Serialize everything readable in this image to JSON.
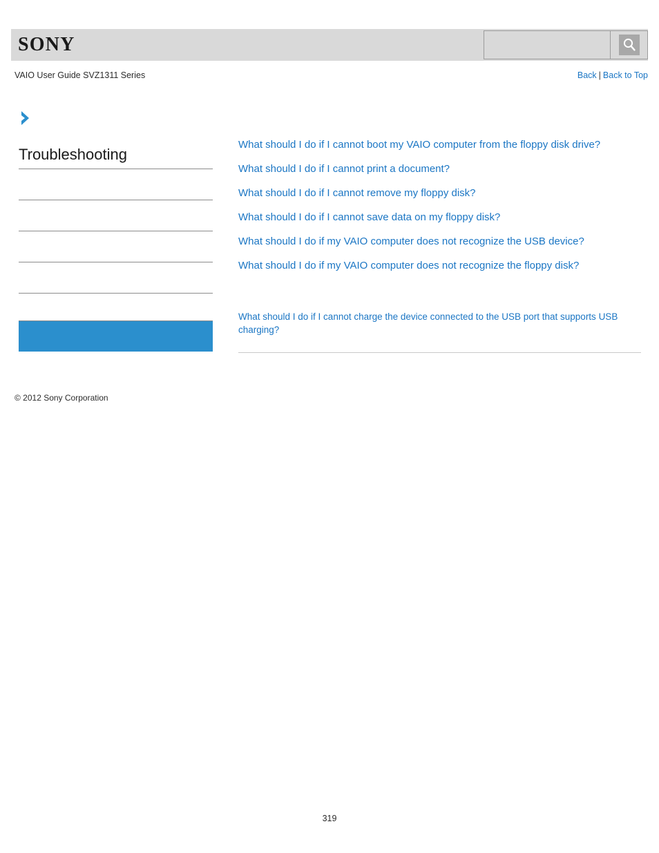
{
  "header": {
    "logo_text": "SONY",
    "search": {
      "value": "",
      "placeholder": "",
      "icon": "search-icon"
    }
  },
  "subheader": {
    "guide_title": "VAIO User Guide SVZ1311 Series",
    "back_label": "Back",
    "separator": "|",
    "back_to_top_label": "Back to Top"
  },
  "sidebar": {
    "chevron_icon": "chevron-right-icon",
    "title": "Troubleshooting",
    "entries": [
      "",
      "",
      "",
      ""
    ],
    "highlight_box": {
      "label": "",
      "color": "#2b8fcd"
    }
  },
  "content": {
    "links": [
      "What should I do if I cannot boot my VAIO computer from the floppy disk drive?",
      "What should I do if I cannot print a document?",
      "What should I do if I cannot remove my floppy disk?",
      "What should I do if I cannot save data on my floppy disk?",
      "What should I do if my VAIO computer does not recognize the USB device?",
      "What should I do if my VAIO computer does not recognize the floppy disk?"
    ],
    "secondary_link": "What should I do if I cannot charge the device connected to the USB port that supports USB charging?"
  },
  "footer": {
    "copyright": "© 2012 Sony Corporation",
    "page_number": "319"
  },
  "colors": {
    "link": "#1b76c4",
    "header_bg": "#d9d9d9",
    "accent": "#2b8fcd",
    "rule": "#8c8c8c"
  }
}
